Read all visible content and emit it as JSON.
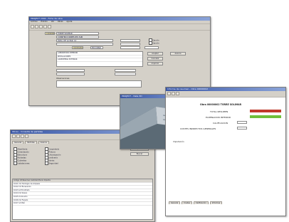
{
  "back": {
    "title": "PROJECT 2000 - Ficha de obra",
    "menus": [
      "Archivo",
      "Edición",
      "Ver",
      "Obras",
      "Ayuda"
    ],
    "project_value": "1000000",
    "project_name": "TORRE SOLIMAR",
    "address_value": "AVDA. DE LA PAZ, 14",
    "status_value": "EN CURSO",
    "client_value": "CONSTRUCCIONES DEL SUR",
    "date_value": "01/03/2001",
    "list_rows": [
      "LABORATORIO INTERIOR",
      "INSTALACIONES",
      "CARPINTERIA EXTERIOR"
    ],
    "button_labels": [
      "Aceptar",
      "Cancelar",
      "Imprimir",
      "Avance"
    ],
    "lower_label": "Observaciones"
  },
  "left": {
    "title": "Obras - Consulta de partidas",
    "tabs": [
      "General",
      "Partidas",
      "Avance"
    ],
    "checkbox_labels": [
      "Albañilería",
      "Cimentación",
      "Estructura",
      "Fachadas",
      "Cubiertas",
      "Instalaciones",
      "Carpintería",
      "Pintura",
      "Urbanización",
      "Jardinería",
      "Varios",
      "Seguridad"
    ],
    "side_buttons": [
      "Aplicar",
      "Buscar"
    ],
    "grid_header": "Código   Ud   Resumen   Cantidad   Precio   Importe",
    "grid_rows": [
      "10.01   m2   Hormigón de limpieza",
      "10.02   m3   Excavación",
      "10.03   ud   Encofrado",
      "10.04   m2   Solera",
      "10.05   ml   Zuncho",
      "10.06   m2   Forjado",
      "10.07   ud   Pilar"
    ]
  },
  "middle": {
    "title": "PROJECT - Vista 3D"
  },
  "right": {
    "title": "Informe de resumen - Obra 00000002",
    "header": "Obra 00000002 TORRE SOLIMAR",
    "rows": [
      "TOTAL RESUMEN",
      "ELIMINACION INTERIOR",
      "CALIFICACION",
      "COSTES INDIRECTOS GENERALES"
    ],
    "bottom_label": "Imputación",
    "tabs": [
      "General",
      "Costes",
      "Calificación",
      "Informes"
    ],
    "colors": {
      "red": "#c0392b",
      "green": "#6fbf3a"
    }
  }
}
